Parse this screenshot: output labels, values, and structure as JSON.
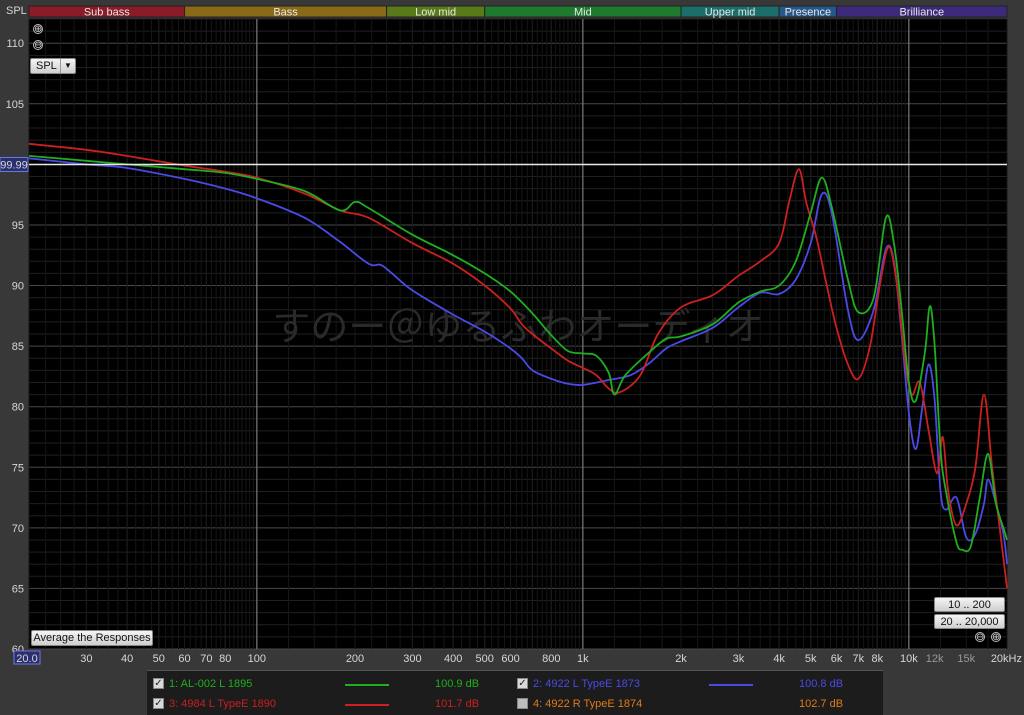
{
  "chart_data": {
    "type": "line",
    "ylabel": "SPL",
    "ylim": [
      60,
      112
    ],
    "xlim": [
      20,
      20000
    ],
    "x_scale": "log",
    "grid": true,
    "y_ticks": [
      60,
      65,
      70,
      75,
      80,
      85,
      90,
      95,
      100,
      105,
      110
    ],
    "x_ticks": [
      {
        "value": 20,
        "label": "20.0"
      },
      {
        "value": 30,
        "label": "30"
      },
      {
        "value": 40,
        "label": "40"
      },
      {
        "value": 50,
        "label": "50"
      },
      {
        "value": 60,
        "label": "60"
      },
      {
        "value": 70,
        "label": "70"
      },
      {
        "value": 80,
        "label": "80"
      },
      {
        "value": 100,
        "label": "100"
      },
      {
        "value": 200,
        "label": "200"
      },
      {
        "value": 300,
        "label": "300"
      },
      {
        "value": 400,
        "label": "400"
      },
      {
        "value": 500,
        "label": "500"
      },
      {
        "value": 600,
        "label": "600"
      },
      {
        "value": 800,
        "label": "800"
      },
      {
        "value": 1000,
        "label": "1k"
      },
      {
        "value": 2000,
        "label": "2k"
      },
      {
        "value": 3000,
        "label": "3k"
      },
      {
        "value": 4000,
        "label": "4k"
      },
      {
        "value": 5000,
        "label": "5k"
      },
      {
        "value": 6000,
        "label": "6k"
      },
      {
        "value": 7000,
        "label": "7k"
      },
      {
        "value": 8000,
        "label": "8k"
      },
      {
        "value": 10000,
        "label": "10k"
      },
      {
        "value": 12000,
        "label": "12k",
        "minor": true
      },
      {
        "value": 15000,
        "label": "15k",
        "minor": true
      },
      {
        "value": 20000,
        "label": "20kHz"
      }
    ],
    "cursor_level": {
      "value": 99.99,
      "label": "99.99"
    },
    "bands": [
      {
        "name": "Sub bass",
        "from": 20,
        "to": 60,
        "color": "#8a1b27"
      },
      {
        "name": "Bass",
        "from": 60,
        "to": 250,
        "color": "#8a6a16"
      },
      {
        "name": "Low mid",
        "from": 250,
        "to": 500,
        "color": "#587a18"
      },
      {
        "name": "Mid",
        "from": 500,
        "to": 2000,
        "color": "#1d7a2e"
      },
      {
        "name": "Upper mid",
        "from": 2000,
        "to": 4000,
        "color": "#1b6e6a"
      },
      {
        "name": "Presence",
        "from": 4000,
        "to": 6000,
        "color": "#27578a"
      },
      {
        "name": "Brilliance",
        "from": 6000,
        "to": 20000,
        "color": "#3d2a7a"
      }
    ],
    "watermark": "すのー＠ゆるふわオーディオ",
    "series": [
      {
        "name": "1: AL-002 L 1895",
        "color": "#1fae1f",
        "value": "100.9 dB",
        "points": [
          [
            20,
            100.7
          ],
          [
            30,
            100.3
          ],
          [
            40,
            100.0
          ],
          [
            60,
            99.6
          ],
          [
            80,
            99.3
          ],
          [
            100,
            98.8
          ],
          [
            140,
            97.8
          ],
          [
            180,
            96.2
          ],
          [
            200,
            96.9
          ],
          [
            220,
            96.4
          ],
          [
            300,
            94.2
          ],
          [
            400,
            92.5
          ],
          [
            500,
            91.0
          ],
          [
            600,
            89.5
          ],
          [
            700,
            87.7
          ],
          [
            800,
            85.9
          ],
          [
            900,
            84.6
          ],
          [
            1000,
            84.4
          ],
          [
            1100,
            84.2
          ],
          [
            1200,
            82.8
          ],
          [
            1250,
            81.0
          ],
          [
            1350,
            82.6
          ],
          [
            1600,
            84.5
          ],
          [
            1800,
            85.6
          ],
          [
            2000,
            85.8
          ],
          [
            2500,
            86.8
          ],
          [
            3000,
            88.6
          ],
          [
            3500,
            89.5
          ],
          [
            4000,
            90.0
          ],
          [
            4500,
            92.0
          ],
          [
            5000,
            96.0
          ],
          [
            5400,
            98.9
          ],
          [
            5800,
            96.5
          ],
          [
            6500,
            90.5
          ],
          [
            7000,
            87.8
          ],
          [
            7800,
            89.0
          ],
          [
            8500,
            95.6
          ],
          [
            9000,
            93.5
          ],
          [
            9500,
            88.0
          ],
          [
            10000,
            82.0
          ],
          [
            10500,
            80.5
          ],
          [
            11200,
            84.5
          ],
          [
            11600,
            88.3
          ],
          [
            12000,
            85.0
          ],
          [
            12500,
            76.5
          ],
          [
            13000,
            73.0
          ],
          [
            14000,
            68.8
          ],
          [
            14600,
            68.2
          ],
          [
            15500,
            68.5
          ],
          [
            16500,
            72.5
          ],
          [
            17500,
            76.1
          ],
          [
            18500,
            72.0
          ],
          [
            19500,
            70.0
          ],
          [
            20000,
            69.0
          ]
        ]
      },
      {
        "name": "2: 4922 L TypeE 1873",
        "color": "#4a4ae8",
        "value": "100.8 dB",
        "points": [
          [
            20,
            100.5
          ],
          [
            30,
            100.0
          ],
          [
            40,
            99.7
          ],
          [
            60,
            98.8
          ],
          [
            80,
            98.0
          ],
          [
            100,
            97.2
          ],
          [
            140,
            95.6
          ],
          [
            180,
            93.6
          ],
          [
            220,
            91.8
          ],
          [
            240,
            91.7
          ],
          [
            260,
            91.0
          ],
          [
            300,
            89.6
          ],
          [
            400,
            87.6
          ],
          [
            500,
            86.2
          ],
          [
            600,
            84.8
          ],
          [
            650,
            84.0
          ],
          [
            700,
            83.0
          ],
          [
            800,
            82.3
          ],
          [
            900,
            81.9
          ],
          [
            1000,
            81.8
          ],
          [
            1200,
            82.2
          ],
          [
            1400,
            82.6
          ],
          [
            1600,
            83.6
          ],
          [
            1800,
            84.8
          ],
          [
            2000,
            85.4
          ],
          [
            2500,
            86.5
          ],
          [
            3000,
            88.2
          ],
          [
            3500,
            89.4
          ],
          [
            4000,
            89.3
          ],
          [
            4500,
            90.5
          ],
          [
            5000,
            93.5
          ],
          [
            5400,
            97.5
          ],
          [
            5800,
            96.0
          ],
          [
            6500,
            88.0
          ],
          [
            7000,
            85.5
          ],
          [
            7800,
            88.0
          ],
          [
            8500,
            93.0
          ],
          [
            9000,
            92.0
          ],
          [
            9500,
            86.0
          ],
          [
            10000,
            79.5
          ],
          [
            10500,
            76.5
          ],
          [
            11000,
            80.0
          ],
          [
            11500,
            83.5
          ],
          [
            12000,
            80.5
          ],
          [
            12500,
            73.0
          ],
          [
            13000,
            71.5
          ],
          [
            14000,
            72.5
          ],
          [
            15000,
            69.2
          ],
          [
            16000,
            69.5
          ],
          [
            17000,
            72.0
          ],
          [
            17500,
            74.0
          ],
          [
            18500,
            72.0
          ],
          [
            19500,
            69.5
          ],
          [
            20000,
            67.0
          ]
        ]
      },
      {
        "name": "3: 4984 L TypeE 1890",
        "color": "#cc1f1f",
        "value": "101.7 dB",
        "points": [
          [
            20,
            101.7
          ],
          [
            30,
            101.2
          ],
          [
            40,
            100.7
          ],
          [
            60,
            99.9
          ],
          [
            80,
            99.4
          ],
          [
            100,
            98.9
          ],
          [
            140,
            97.6
          ],
          [
            180,
            96.2
          ],
          [
            220,
            95.6
          ],
          [
            300,
            93.5
          ],
          [
            400,
            91.8
          ],
          [
            500,
            90.0
          ],
          [
            600,
            88.1
          ],
          [
            650,
            86.8
          ],
          [
            700,
            86.0
          ],
          [
            800,
            84.8
          ],
          [
            900,
            83.8
          ],
          [
            1000,
            83.2
          ],
          [
            1100,
            82.6
          ],
          [
            1200,
            81.5
          ],
          [
            1300,
            81.2
          ],
          [
            1500,
            82.6
          ],
          [
            1700,
            86.0
          ],
          [
            2000,
            88.2
          ],
          [
            2500,
            89.2
          ],
          [
            3000,
            90.8
          ],
          [
            3500,
            92.0
          ],
          [
            4000,
            93.5
          ],
          [
            4300,
            97.0
          ],
          [
            4600,
            99.6
          ],
          [
            4850,
            96.8
          ],
          [
            5200,
            94.0
          ],
          [
            5600,
            90.0
          ],
          [
            6000,
            86.5
          ],
          [
            6500,
            83.5
          ],
          [
            7000,
            82.3
          ],
          [
            7600,
            85.0
          ],
          [
            8200,
            90.5
          ],
          [
            8700,
            93.2
          ],
          [
            9200,
            90.0
          ],
          [
            9700,
            84.0
          ],
          [
            10200,
            81.0
          ],
          [
            10800,
            82.0
          ],
          [
            11500,
            78.0
          ],
          [
            12200,
            74.5
          ],
          [
            12700,
            77.5
          ],
          [
            13200,
            73.0
          ],
          [
            14000,
            70.2
          ],
          [
            15000,
            72.0
          ],
          [
            16000,
            75.0
          ],
          [
            17000,
            81.0
          ],
          [
            18000,
            75.0
          ],
          [
            19000,
            70.0
          ],
          [
            20000,
            65.0
          ]
        ]
      },
      {
        "name": "4: 4922 R TypeE 1874",
        "color": "#e07a1a",
        "value": "102.7 dB",
        "visible": false,
        "points": []
      }
    ]
  },
  "controls": {
    "spl_select": "SPL",
    "average_button": "Average the Responses",
    "range_button_1": "10 .. 200",
    "range_button_2": "20 .. 20,000",
    "zoom_in": "⊕",
    "zoom_out": "⊖"
  }
}
